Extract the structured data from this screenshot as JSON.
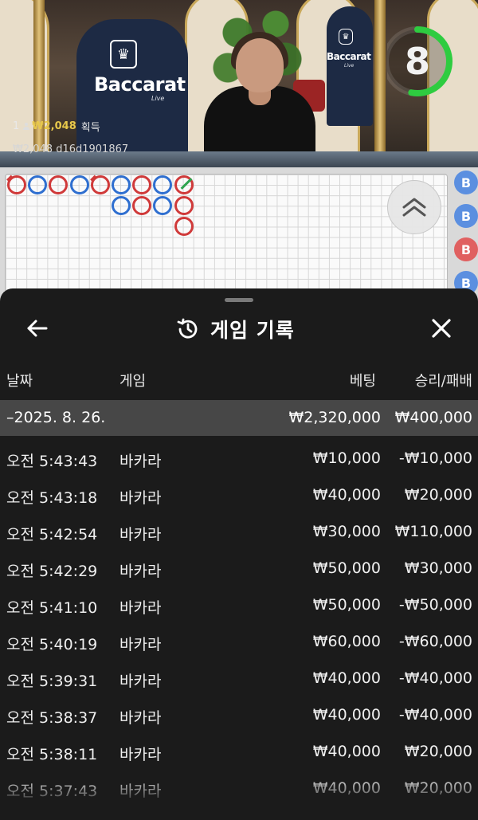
{
  "video": {
    "logo_brand": "Baccarat",
    "logo_sub": "Live",
    "countdown": "8",
    "countdown_fraction": 0.53,
    "players_count": "1",
    "win_amount": "₩2,048",
    "win_suffix": "획득",
    "balance_and_id": "₩2,048  d16d1901867"
  },
  "roadmap": {
    "columns": [
      [
        "B"
      ],
      [
        "P"
      ],
      [
        "B"
      ],
      [
        "P"
      ],
      [
        "B"
      ],
      [
        "P",
        "P"
      ],
      [
        "B",
        "B"
      ],
      [
        "P",
        "P"
      ],
      [
        "T",
        "B",
        "B"
      ]
    ],
    "side_predictions": [
      {
        "letter": "B",
        "color": "#5b8fe0"
      },
      {
        "letter": "B",
        "color": "#5b8fe0"
      },
      {
        "letter": "B",
        "color": "#e06060"
      },
      {
        "letter": "B",
        "color": "#5b8fe0"
      }
    ],
    "colors": {
      "player": "#2f6fd0",
      "banker": "#d03a3a",
      "tie": "#2ea44f"
    }
  },
  "sheet": {
    "title": "게임 기록",
    "back_icon": "arrow-left-icon",
    "history_icon": "history-icon",
    "close_icon": "close-icon",
    "columns": {
      "date": "날짜",
      "game": "게임",
      "bet": "베팅",
      "winloss": "승리/패배"
    },
    "date_group": {
      "label": "–2025. 8. 26.",
      "bet": "₩2,320,000",
      "winloss": "₩400,000"
    },
    "rows": [
      {
        "time": "오전 5:43:43",
        "game": "바카라",
        "bet": "₩10,000",
        "winloss": "-₩10,000"
      },
      {
        "time": "오전 5:43:18",
        "game": "바카라",
        "bet": "₩40,000",
        "winloss": "₩20,000"
      },
      {
        "time": "오전 5:42:54",
        "game": "바카라",
        "bet": "₩30,000",
        "winloss": "₩110,000"
      },
      {
        "time": "오전 5:42:29",
        "game": "바카라",
        "bet": "₩50,000",
        "winloss": "₩30,000"
      },
      {
        "time": "오전 5:41:10",
        "game": "바카라",
        "bet": "₩50,000",
        "winloss": "-₩50,000"
      },
      {
        "time": "오전 5:40:19",
        "game": "바카라",
        "bet": "₩60,000",
        "winloss": "-₩60,000"
      },
      {
        "time": "오전 5:39:31",
        "game": "바카라",
        "bet": "₩40,000",
        "winloss": "-₩40,000"
      },
      {
        "time": "오전 5:38:37",
        "game": "바카라",
        "bet": "₩40,000",
        "winloss": "-₩40,000"
      },
      {
        "time": "오전 5:38:11",
        "game": "바카라",
        "bet": "₩40,000",
        "winloss": "₩20,000"
      },
      {
        "time": "오전 5:37:43",
        "game": "바카라",
        "bet": "₩40,000",
        "winloss": "₩20,000"
      }
    ]
  }
}
